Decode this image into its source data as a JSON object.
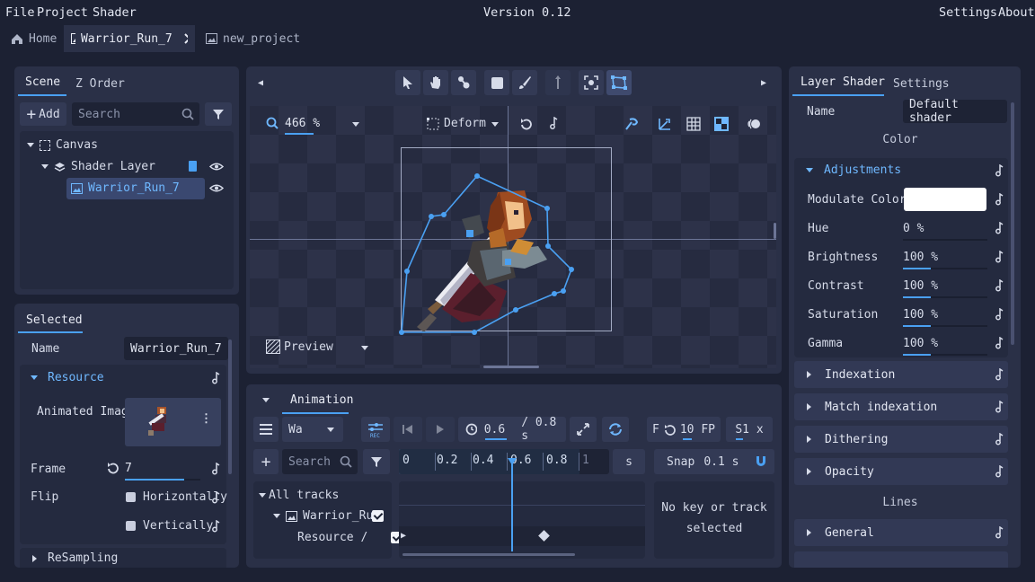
{
  "menu": {
    "file": "File",
    "project": "Project",
    "shader": "Shader",
    "version": "Version 0.12",
    "settings": "Settings",
    "about": "About"
  },
  "tabs": [
    {
      "label": "Home"
    },
    {
      "label": "Warrior_Run_7"
    },
    {
      "label": "new_project"
    }
  ],
  "scene_panel": {
    "tabs": [
      "Scene",
      "Z Order"
    ],
    "add_label": "Add",
    "search_placeholder": "Search",
    "tree": [
      {
        "label": "Canvas"
      },
      {
        "label": "Shader Layer"
      },
      {
        "label": "Warrior_Run_7"
      }
    ]
  },
  "selected_panel": {
    "title": "Selected",
    "name_label": "Name",
    "name_value": "Warrior_Run_7",
    "resource_label": "Resource",
    "animated_image_label": "Animated Image",
    "frame_label": "Frame",
    "frame_value": "7",
    "frame_progress": 0.78,
    "flip_label": "Flip",
    "horizontally": "Horizontally",
    "vertically": "Vertically",
    "resampling": "ReSampling"
  },
  "viewport": {
    "zoom": "466 %",
    "mode": "Deform",
    "preview": "Preview"
  },
  "animation": {
    "tab": "Animation",
    "anim_name": "Wa",
    "current_time": "0.6",
    "total_time": "/ 0.8 s",
    "rec_label": "REC",
    "fps_prefix": "F",
    "fps_value": "10 FP",
    "speed": "S1 x",
    "search_placeholder": "Search",
    "ruler": [
      "0",
      "0.2",
      "0.4",
      "0.6",
      "0.8",
      "1"
    ],
    "unit": "s",
    "snap_label": "Snap",
    "snap_value": "0.1 s",
    "tracks": {
      "all": "All tracks",
      "node": "Warrior_Ru",
      "resource": "Resource /"
    },
    "no_key": "No key or track",
    "selected": "selected"
  },
  "layer_shader": {
    "tabs": [
      "Layer Shader",
      "Settings"
    ],
    "name_label": "Name",
    "name_value": "Default shader",
    "color_header": "Color",
    "adjustments": "Adjustments",
    "modulate_label": "Modulate Color",
    "modulate_color": "#ffffff",
    "params": [
      {
        "label": "Hue",
        "value": "0 %",
        "level": 0.0
      },
      {
        "label": "Brightness",
        "value": "100 %",
        "level": 0.33
      },
      {
        "label": "Contrast",
        "value": "100 %",
        "level": 0.33
      },
      {
        "label": "Saturation",
        "value": "100 %",
        "level": 0.33
      },
      {
        "label": "Gamma",
        "value": "100 %",
        "level": 0.33
      }
    ],
    "sections": [
      "Indexation",
      "Match indexation",
      "Dithering",
      "Opacity"
    ],
    "lines_header": "Lines",
    "general": "General"
  },
  "colors": {
    "accent": "#4aa0f2",
    "panel": "#2a3047",
    "background": "#1c2133"
  }
}
